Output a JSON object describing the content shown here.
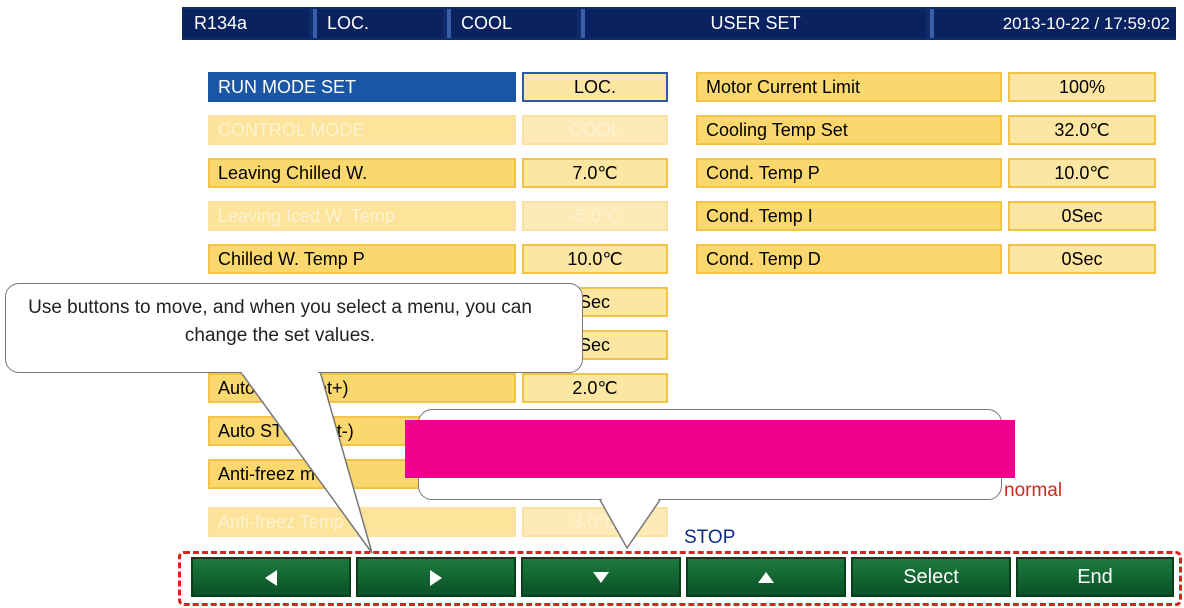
{
  "topbar": {
    "refrigerant": "R134a",
    "location": "LOC.",
    "mode": "COOL",
    "screen": "USER SET",
    "datetime": "2013-10-22 / 17:59:02"
  },
  "left_rows": [
    {
      "label": "RUN MODE SET",
      "value": "LOC."
    },
    {
      "label": "CONTROL MODE",
      "value": "COOL"
    },
    {
      "label": "Leaving Chilled W.",
      "value": "7.0℃"
    },
    {
      "label": "Leaving Iced W. Temp",
      "value": "-5.0℃"
    },
    {
      "label": "Chilled W. Temp P",
      "value": "10.0℃"
    },
    {
      "label": "",
      "value": "Sec"
    },
    {
      "label": "",
      "value": "Sec"
    },
    {
      "label": "Auto RUN(Set+)",
      "value": "2.0℃"
    },
    {
      "label": "Auto STOP(Set-)",
      "value": ""
    },
    {
      "label": "Anti-freez mode",
      "value": ""
    },
    {
      "label": "Anti-freez Temp",
      "value": "3.0℃"
    }
  ],
  "right_rows": [
    {
      "label": "Motor Current Limit",
      "value": "100%"
    },
    {
      "label": "Cooling Temp Set",
      "value": "32.0℃"
    },
    {
      "label": "Cond. Temp P",
      "value": "10.0℃"
    },
    {
      "label": "Cond. Temp I",
      "value": "0Sec"
    },
    {
      "label": "Cond. Temp D",
      "value": "0Sec"
    }
  ],
  "status": {
    "normal": "normal",
    "stop": "STOP"
  },
  "callout_text": "Use buttons to move, and when you select a menu, you can change the set values.",
  "buttons": {
    "left": "left-arrow-icon",
    "right": "right-arrow-icon",
    "down": "down-arrow-icon",
    "up": "up-arrow-icon",
    "select": "Select",
    "end": "End"
  },
  "colors": {
    "highlight_box": "#ec008c",
    "button_green": "#0c5126",
    "row_fill": "#fbd86e",
    "selected_row": "#1a55a6"
  }
}
